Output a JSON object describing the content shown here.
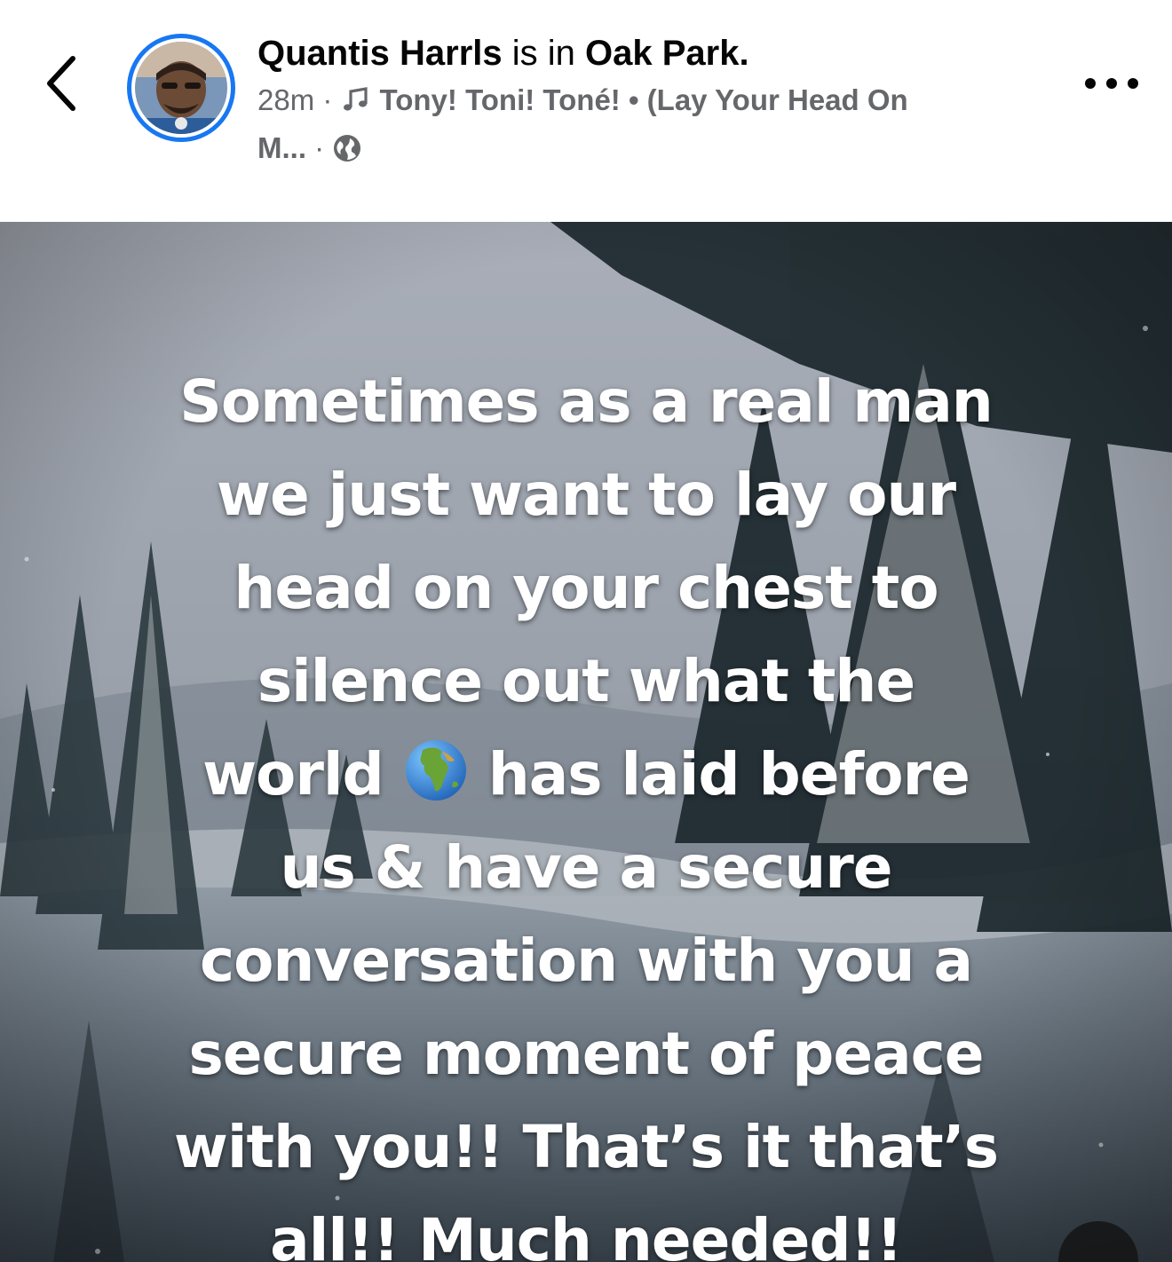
{
  "post": {
    "author_name": "Quantis Harrls",
    "location_connector": " is in ",
    "location": "Oak Park",
    "period": ".",
    "time": "28m",
    "sep": " · ",
    "song_line1": "Tony! Toni! Toné! • (Lay Your Head On",
    "song_line2": "M...",
    "privacy_icon": "globe-icon"
  },
  "status_text": {
    "line1": "Sometimes as a real man",
    "line2": "we just want to lay our",
    "line3": "head on your chest to",
    "line4": "silence out what the",
    "line5a": "world",
    "line5b": "has laid before",
    "line6": "us & have a secure",
    "line7": "conversation with you a",
    "line8": "secure moment of peace",
    "line9": "with you!! That’s it that’s",
    "line10": "all!! Much needed!!"
  },
  "icons": {
    "back": "chevron-left-icon",
    "more": "more-dots-icon",
    "music": "music-note-icon",
    "emoji": "earth-globe-emoji"
  },
  "colors": {
    "avatar_ring": "#1877f2",
    "secondary_text": "#65676b",
    "primary_text": "#050505"
  }
}
